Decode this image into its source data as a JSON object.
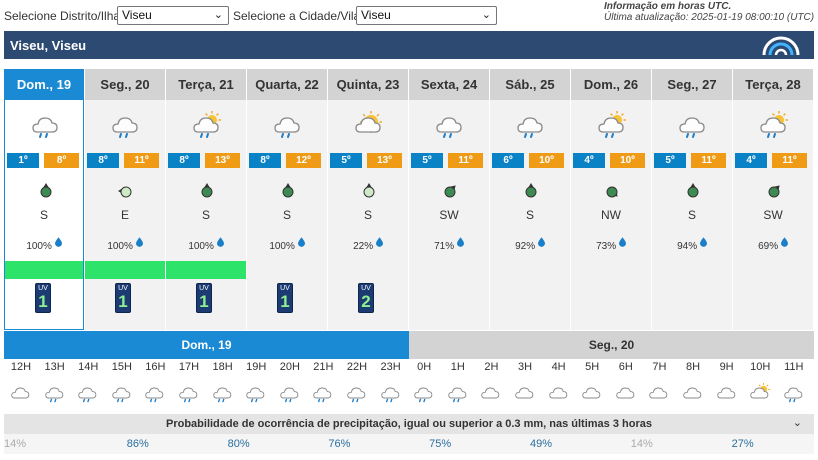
{
  "selectors": {
    "district_label": "Selecione Distrito/Ilha:",
    "district_value": "Viseu",
    "city_label": "Selecione a Cidade/Vila:",
    "city_value": "Viseu"
  },
  "info": {
    "line1": "Informação em horas UTC.",
    "line2": "Última atualização: 2025-01-19 08:00:10 (UTC)"
  },
  "location": {
    "title": "Viseu, Viseu"
  },
  "days": [
    {
      "label": "Dom., 19",
      "icon": "cloud-rain-icon",
      "tmin": "1º",
      "tmax": "8º",
      "wind_icon": "wind-arrow-icon",
      "wind_dir": "S",
      "prob": "100%"
    },
    {
      "label": "Seg., 20",
      "icon": "cloud-rain-icon",
      "tmin": "8º",
      "tmax": "11º",
      "wind_icon": "wind-arrow-icon",
      "wind_dir": "E",
      "prob": "100%"
    },
    {
      "label": "Terça, 21",
      "icon": "sun-cloud-rain-icon",
      "tmin": "8º",
      "tmax": "13º",
      "wind_icon": "wind-arrow-icon",
      "wind_dir": "S",
      "prob": "100%"
    },
    {
      "label": "Quarta, 22",
      "icon": "cloud-rain-icon",
      "tmin": "8º",
      "tmax": "12º",
      "wind_icon": "wind-arrow-icon",
      "wind_dir": "S",
      "prob": "100%"
    },
    {
      "label": "Quinta, 23",
      "icon": "sun-cloud-icon",
      "tmin": "5º",
      "tmax": "13º",
      "wind_icon": "wind-arrow-icon",
      "wind_dir": "S",
      "prob": "22%"
    },
    {
      "label": "Sexta, 24",
      "icon": "cloud-rain-icon",
      "tmin": "5º",
      "tmax": "11º",
      "wind_icon": "wind-arrow-icon",
      "wind_dir": "SW",
      "prob": "71%"
    },
    {
      "label": "Sáb., 25",
      "icon": "cloud-rain-icon",
      "tmin": "6º",
      "tmax": "10º",
      "wind_icon": "wind-arrow-icon",
      "wind_dir": "S",
      "prob": "92%"
    },
    {
      "label": "Dom., 26",
      "icon": "sun-cloud-rain-icon",
      "tmin": "4º",
      "tmax": "10º",
      "wind_icon": "wind-arrow-icon",
      "wind_dir": "NW",
      "prob": "73%"
    },
    {
      "label": "Seg., 27",
      "icon": "cloud-rain-icon",
      "tmin": "5º",
      "tmax": "11º",
      "wind_icon": "wind-arrow-icon",
      "wind_dir": "S",
      "prob": "94%"
    },
    {
      "label": "Terça, 28",
      "icon": "sun-cloud-rain-icon",
      "tmin": "4º",
      "tmax": "11º",
      "wind_icon": "wind-arrow-icon",
      "wind_dir": "SW",
      "prob": "69%"
    }
  ],
  "uv": [
    {
      "label": "UV",
      "value": "1"
    },
    {
      "label": "UV",
      "value": "1"
    },
    {
      "label": "UV",
      "value": "1"
    },
    {
      "label": "UV",
      "value": "1"
    },
    {
      "label": "UV",
      "value": "2"
    }
  ],
  "hourly": {
    "day1": "Dom., 19",
    "day2": "Seg., 20",
    "hours": [
      "12H",
      "13H",
      "14H",
      "15H",
      "16H",
      "17H",
      "18H",
      "19H",
      "20H",
      "21H",
      "22H",
      "23H",
      "0H",
      "1H",
      "2H",
      "3H",
      "4H",
      "5H",
      "6H",
      "7H",
      "8H",
      "9H",
      "10H",
      "11H"
    ],
    "precip_title": "Probabilidade de ocorrência de precipitação, igual ou superior a 0.3 mm, nas últimas 3 horas",
    "precip_values": [
      "14%",
      "86%",
      "80%",
      "76%",
      "75%",
      "49%",
      "14%",
      "27%"
    ]
  },
  "colors": {
    "header_bar": "#2d4a73",
    "active_day": "#1a8ad4",
    "tmin": "#0a82c6",
    "tmax": "#ef9b16",
    "green_bar": "#2ee36a"
  }
}
